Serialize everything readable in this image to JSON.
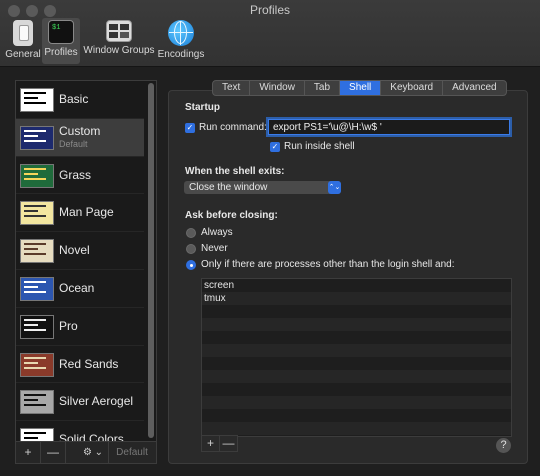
{
  "window": {
    "title": "Profiles"
  },
  "toolbar": [
    {
      "label": "General",
      "icon": "switch-icon"
    },
    {
      "label": "Profiles",
      "icon": "terminal-icon"
    },
    {
      "label": "Window Groups",
      "icon": "window-groups-icon"
    },
    {
      "label": "Encodings",
      "icon": "globe-icon"
    }
  ],
  "profiles": [
    {
      "name": "Basic",
      "sub": "",
      "bg": "#ffffff",
      "fg": "#000000"
    },
    {
      "name": "Custom",
      "sub": "Default",
      "bg": "#1d2a6e",
      "fg": "#ffffff"
    },
    {
      "name": "Grass",
      "sub": "",
      "bg": "#1f6b3b",
      "fg": "#f5d55a"
    },
    {
      "name": "Man Page",
      "sub": "",
      "bg": "#f2e6a0",
      "fg": "#333333"
    },
    {
      "name": "Novel",
      "sub": "",
      "bg": "#e6dcc0",
      "fg": "#5a3b2a"
    },
    {
      "name": "Ocean",
      "sub": "",
      "bg": "#2c56b0",
      "fg": "#ffffff"
    },
    {
      "name": "Pro",
      "sub": "",
      "bg": "#111111",
      "fg": "#f0f0f0"
    },
    {
      "name": "Red Sands",
      "sub": "",
      "bg": "#8a3a2a",
      "fg": "#e8d8b0"
    },
    {
      "name": "Silver Aerogel",
      "sub": "",
      "bg": "#a8a8a8",
      "fg": "#111111"
    },
    {
      "name": "Solid Colors",
      "sub": "",
      "bg": "#ffffff",
      "fg": "#000000"
    }
  ],
  "sidebar_buttons": {
    "add": "+",
    "remove": "—",
    "gear": "⚙ ⌄",
    "default": "Default"
  },
  "tabs": [
    "Text",
    "Window",
    "Tab",
    "Shell",
    "Keyboard",
    "Advanced"
  ],
  "active_tab": "Shell",
  "startup": {
    "heading": "Startup",
    "run_command_label": "Run command:",
    "run_command_value": "export PS1='\\u@\\H:\\w$ '",
    "run_inside_shell_label": "Run inside shell"
  },
  "shell_exit": {
    "heading": "When the shell exits:",
    "selected": "Close the window",
    "arrow": "⌃⌄"
  },
  "ask_closing": {
    "heading": "Ask before closing:",
    "options": [
      "Always",
      "Never",
      "Only if there are processes other than the login shell and:"
    ],
    "selected_index": 2
  },
  "processes": [
    "screen",
    "tmux"
  ],
  "list_buttons": {
    "add": "+",
    "remove": "—"
  },
  "help": "?",
  "colors": {
    "accent": "#2f6fe0"
  }
}
